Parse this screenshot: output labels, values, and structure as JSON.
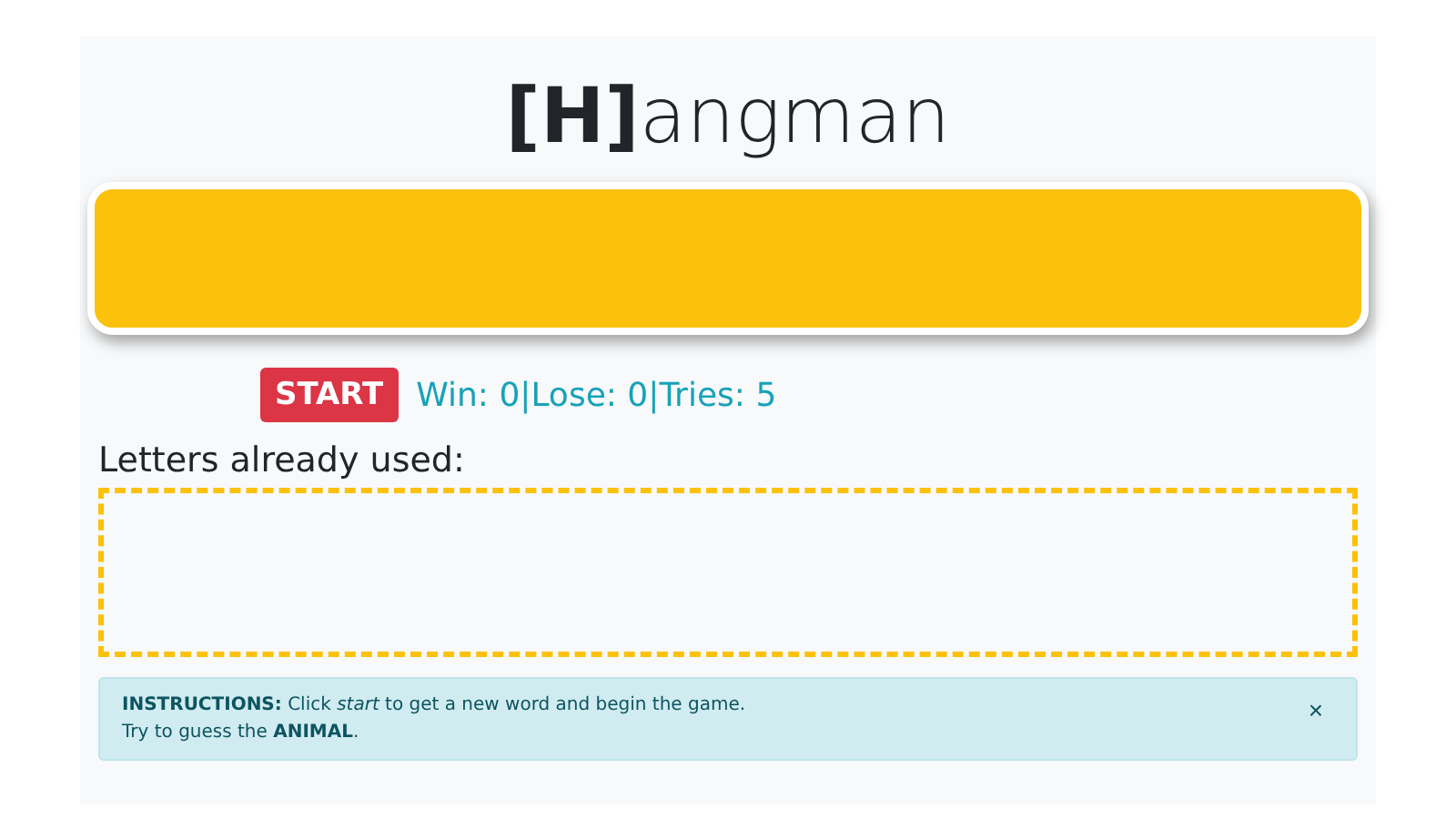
{
  "title": "**[H]**angman",
  "start_button": "START",
  "score": "Win: 0|Lose: 0|Tries: 5",
  "letters_label": "Letters already used:",
  "alert": {
    "lines": [
      "**INSTRUCTIONS:** Click *start* to get a new word and begin the game.",
      "Try to guess the **ANIMAL**."
    ],
    "close": "×"
  }
}
